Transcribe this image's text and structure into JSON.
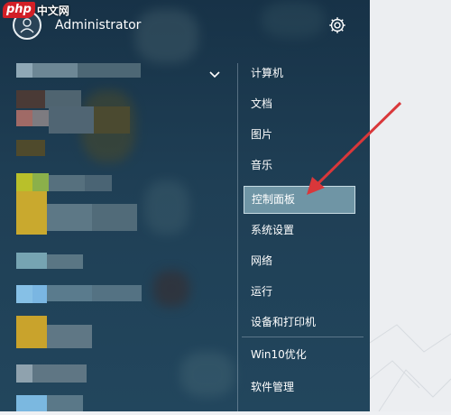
{
  "watermark": {
    "p_text": "php",
    "cn_text": "中文网"
  },
  "user": {
    "name": "Administrator"
  },
  "icons": {
    "avatar": "user-avatar-icon",
    "settings": "gear-icon",
    "expand": "chevron-down-icon"
  },
  "right_menu": {
    "items": [
      {
        "label": "计算机"
      },
      {
        "label": "文档"
      },
      {
        "label": "图片"
      },
      {
        "label": "音乐"
      },
      {
        "label": "控制面板",
        "selected": true
      },
      {
        "label": "系统设置"
      },
      {
        "label": "网络"
      },
      {
        "label": "运行"
      },
      {
        "label": "设备和打印机"
      },
      {
        "label": "Win10优化"
      },
      {
        "label": "软件管理"
      }
    ]
  },
  "colors": {
    "accent_arrow": "#d9373a",
    "selected_bg": "#6f95a5",
    "menu_bg": "#1d3a4f"
  }
}
